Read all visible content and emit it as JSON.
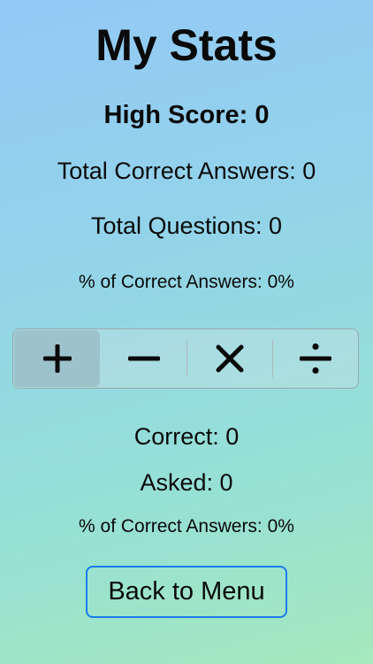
{
  "screen": {
    "title": "My Stats"
  },
  "overall": {
    "high_score": "High Score: 0",
    "total_correct": "Total Correct Answers: 0",
    "total_questions": "Total Questions: 0",
    "percent_correct": "% of Correct Answers: 0%"
  },
  "operation_picker": {
    "selected": "addition",
    "segments": [
      {
        "id": "addition",
        "icon": "plus-icon"
      },
      {
        "id": "subtraction",
        "icon": "minus-icon"
      },
      {
        "id": "multiplication",
        "icon": "multiply-icon"
      },
      {
        "id": "division",
        "icon": "divide-icon"
      }
    ]
  },
  "operation_stats": {
    "correct": "Correct: 0",
    "asked": "Asked: 0",
    "percent_correct": "% of Correct Answers: 0%"
  },
  "actions": {
    "back_label": "Back to Menu"
  },
  "colors": {
    "accent": "#1a7cf0",
    "gradient_top": "#93c9f6",
    "gradient_bottom": "#a5e8bd"
  }
}
